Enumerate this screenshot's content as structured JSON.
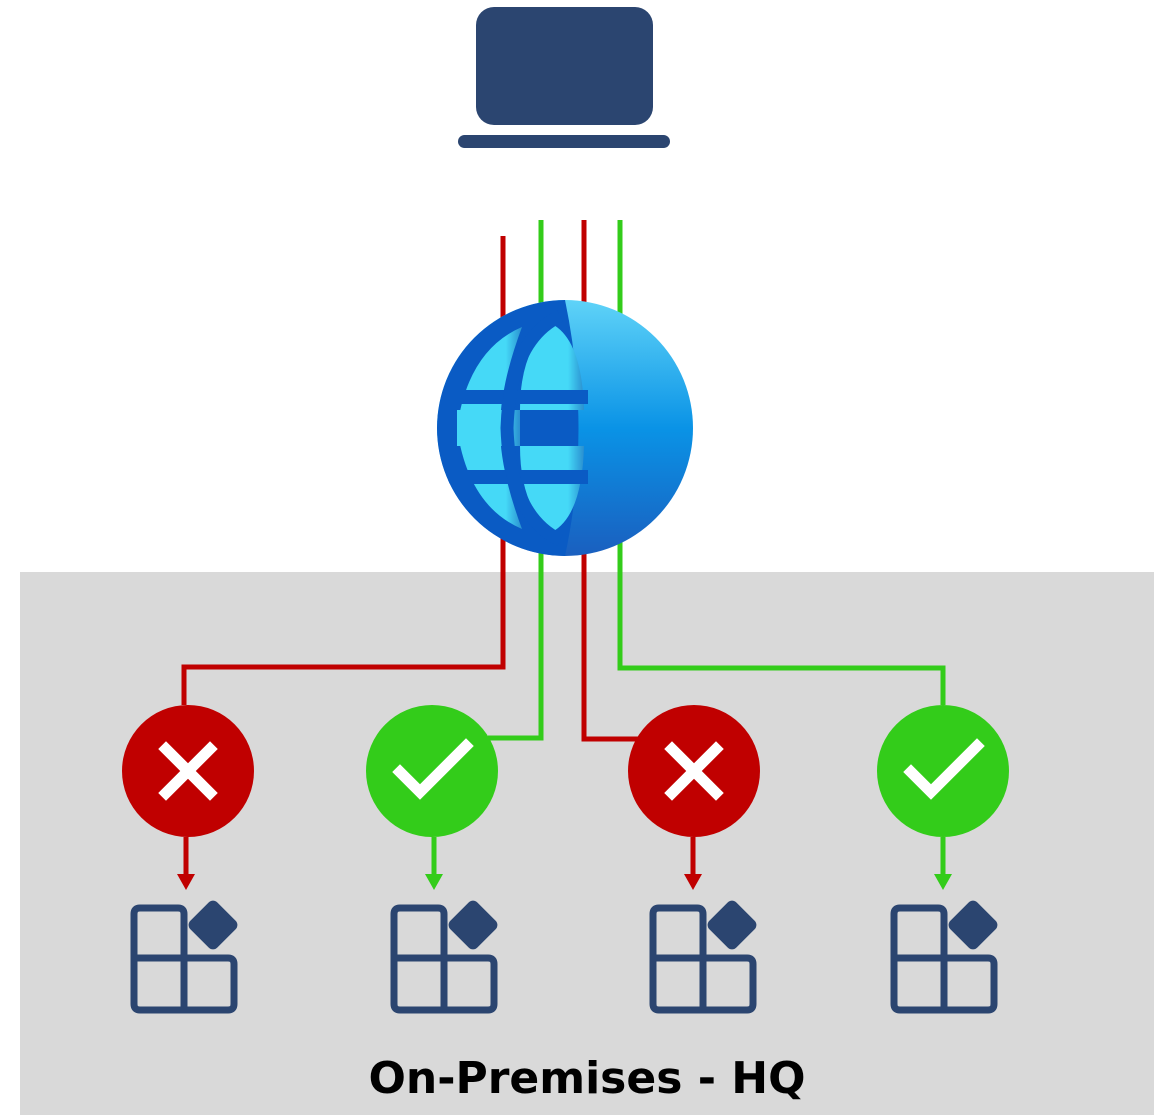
{
  "zone": {
    "label": "On-Premises - HQ",
    "background": "#d9d9d9"
  },
  "client": {
    "icon": "laptop-icon",
    "color": "#2b4570"
  },
  "gateway": {
    "icon": "globe-icon",
    "colors": [
      "#0a5bc4",
      "#45d9f7",
      "#0a8fe0"
    ]
  },
  "colors": {
    "denied": "#c00000",
    "allowed": "#33cc1a",
    "app": "#2b4570"
  },
  "connections": [
    {
      "status": "denied",
      "status_icon": "x-mark-icon",
      "app_icon": "app-grid-icon"
    },
    {
      "status": "allowed",
      "status_icon": "check-mark-icon",
      "app_icon": "app-grid-icon"
    },
    {
      "status": "denied",
      "status_icon": "x-mark-icon",
      "app_icon": "app-grid-icon"
    },
    {
      "status": "allowed",
      "status_icon": "check-mark-icon",
      "app_icon": "app-grid-icon"
    }
  ]
}
